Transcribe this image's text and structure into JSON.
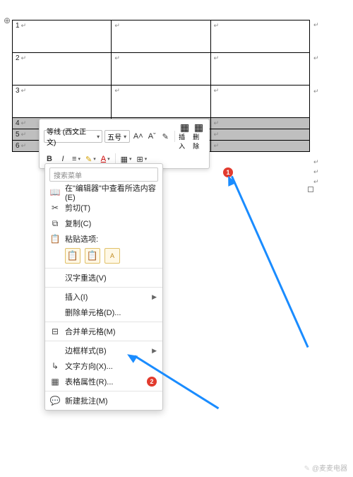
{
  "table": {
    "rows": [
      {
        "num": "1",
        "selected": false,
        "small": false
      },
      {
        "num": "2",
        "selected": false,
        "small": false
      },
      {
        "num": "3",
        "selected": false,
        "small": false
      },
      {
        "num": "4",
        "selected": true,
        "small": true
      },
      {
        "num": "5",
        "selected": true,
        "small": true
      },
      {
        "num": "6",
        "selected": true,
        "small": true
      }
    ]
  },
  "anchor_glyph": "⊕",
  "mini_toolbar": {
    "font_name": "等线 (西文正文)",
    "font_size": "五号",
    "grow": "A˄",
    "shrink": "Aˇ",
    "style_brush": "✎",
    "insert_label": "插入",
    "delete_label": "删除",
    "bold": "B",
    "italic": "I"
  },
  "context_menu": {
    "search_placeholder": "搜索菜单",
    "items": {
      "lookup": "在\"编辑器\"中查看所选内容(E)",
      "cut": "剪切(T)",
      "copy": "复制(C)",
      "paste_opts": "粘贴选项:",
      "hanzi": "汉字重选(V)",
      "insert": "插入(I)",
      "delete_cell": "删除单元格(D)...",
      "merge": "合并单元格(M)",
      "border": "边框样式(B)",
      "text_dir": "文字方向(X)...",
      "props": "表格属性(R)...",
      "comment": "新建批注(M)"
    }
  },
  "badges": {
    "one": "1",
    "two": "2"
  },
  "watermark": "@麦麦电器"
}
